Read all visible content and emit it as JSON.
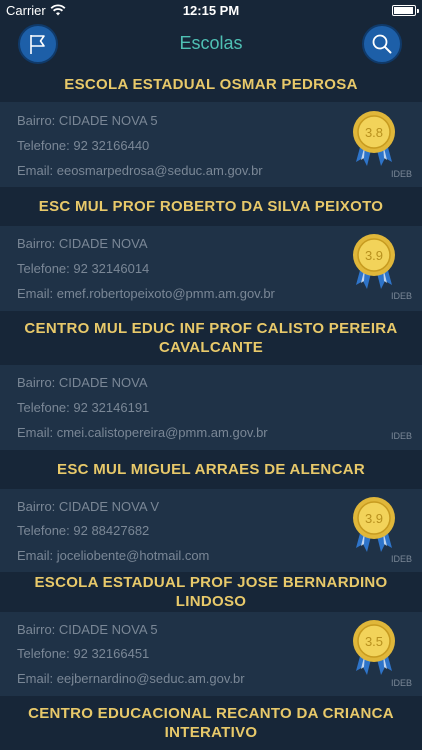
{
  "status_bar": {
    "carrier": "Carrier",
    "time": "12:15 PM"
  },
  "nav": {
    "title": "Escolas",
    "left_icon": "flag-icon",
    "right_icon": "search-icon"
  },
  "schools": [
    {
      "name": "ESCOLA ESTADUAL OSMAR PEDROSA",
      "bairro": "Bairro: CIDADE NOVA 5",
      "telefone": "Telefone: 92 32166440",
      "email": "Email: eeosmarpedrosa@seduc.am.gov.br",
      "ideb": "3.8",
      "ideb_label": "IDEB"
    },
    {
      "name": "ESC MUL PROF ROBERTO DA SILVA PEIXOTO",
      "bairro": "Bairro: CIDADE NOVA",
      "telefone": "Telefone: 92 32146014",
      "email": "Email: emef.robertopeixoto@pmm.am.gov.br",
      "ideb": "3.9",
      "ideb_label": "IDEB"
    },
    {
      "name_line1": "CENTRO MUL EDUC INF PROF CALISTO PEREIRA",
      "name_line2": "CAVALCANTE",
      "bairro": "Bairro: CIDADE NOVA",
      "telefone": "Telefone: 92 32146191",
      "email": "Email: cmei.calistopereira@pmm.am.gov.br",
      "ideb": "",
      "ideb_label": "IDEB"
    },
    {
      "name": "ESC MUL MIGUEL ARRAES DE ALENCAR",
      "bairro": "Bairro: CIDADE NOVA V",
      "telefone": "Telefone: 92 88427682",
      "email": "Email: joceliobente@hotmail.com",
      "ideb": "3.9",
      "ideb_label": "IDEB"
    },
    {
      "name_line1": "ESCOLA ESTADUAL PROF JOSE BERNARDINO",
      "name_line2": "LINDOSO",
      "bairro": "Bairro: CIDADE NOVA 5",
      "telefone": "Telefone: 92 32166451",
      "email": "Email: eejbernardino@seduc.am.gov.br",
      "ideb": "3.5",
      "ideb_label": "IDEB"
    },
    {
      "name_line1": "CENTRO EDUCACIONAL RECANTO DA CRIANCA",
      "name_line2": "INTERATIVO"
    }
  ],
  "colors": {
    "accent": "#4fc0b4",
    "school_name": "#e8c96a",
    "medal_gold": "#e0b73a",
    "ribbon": "#2e74c9"
  }
}
